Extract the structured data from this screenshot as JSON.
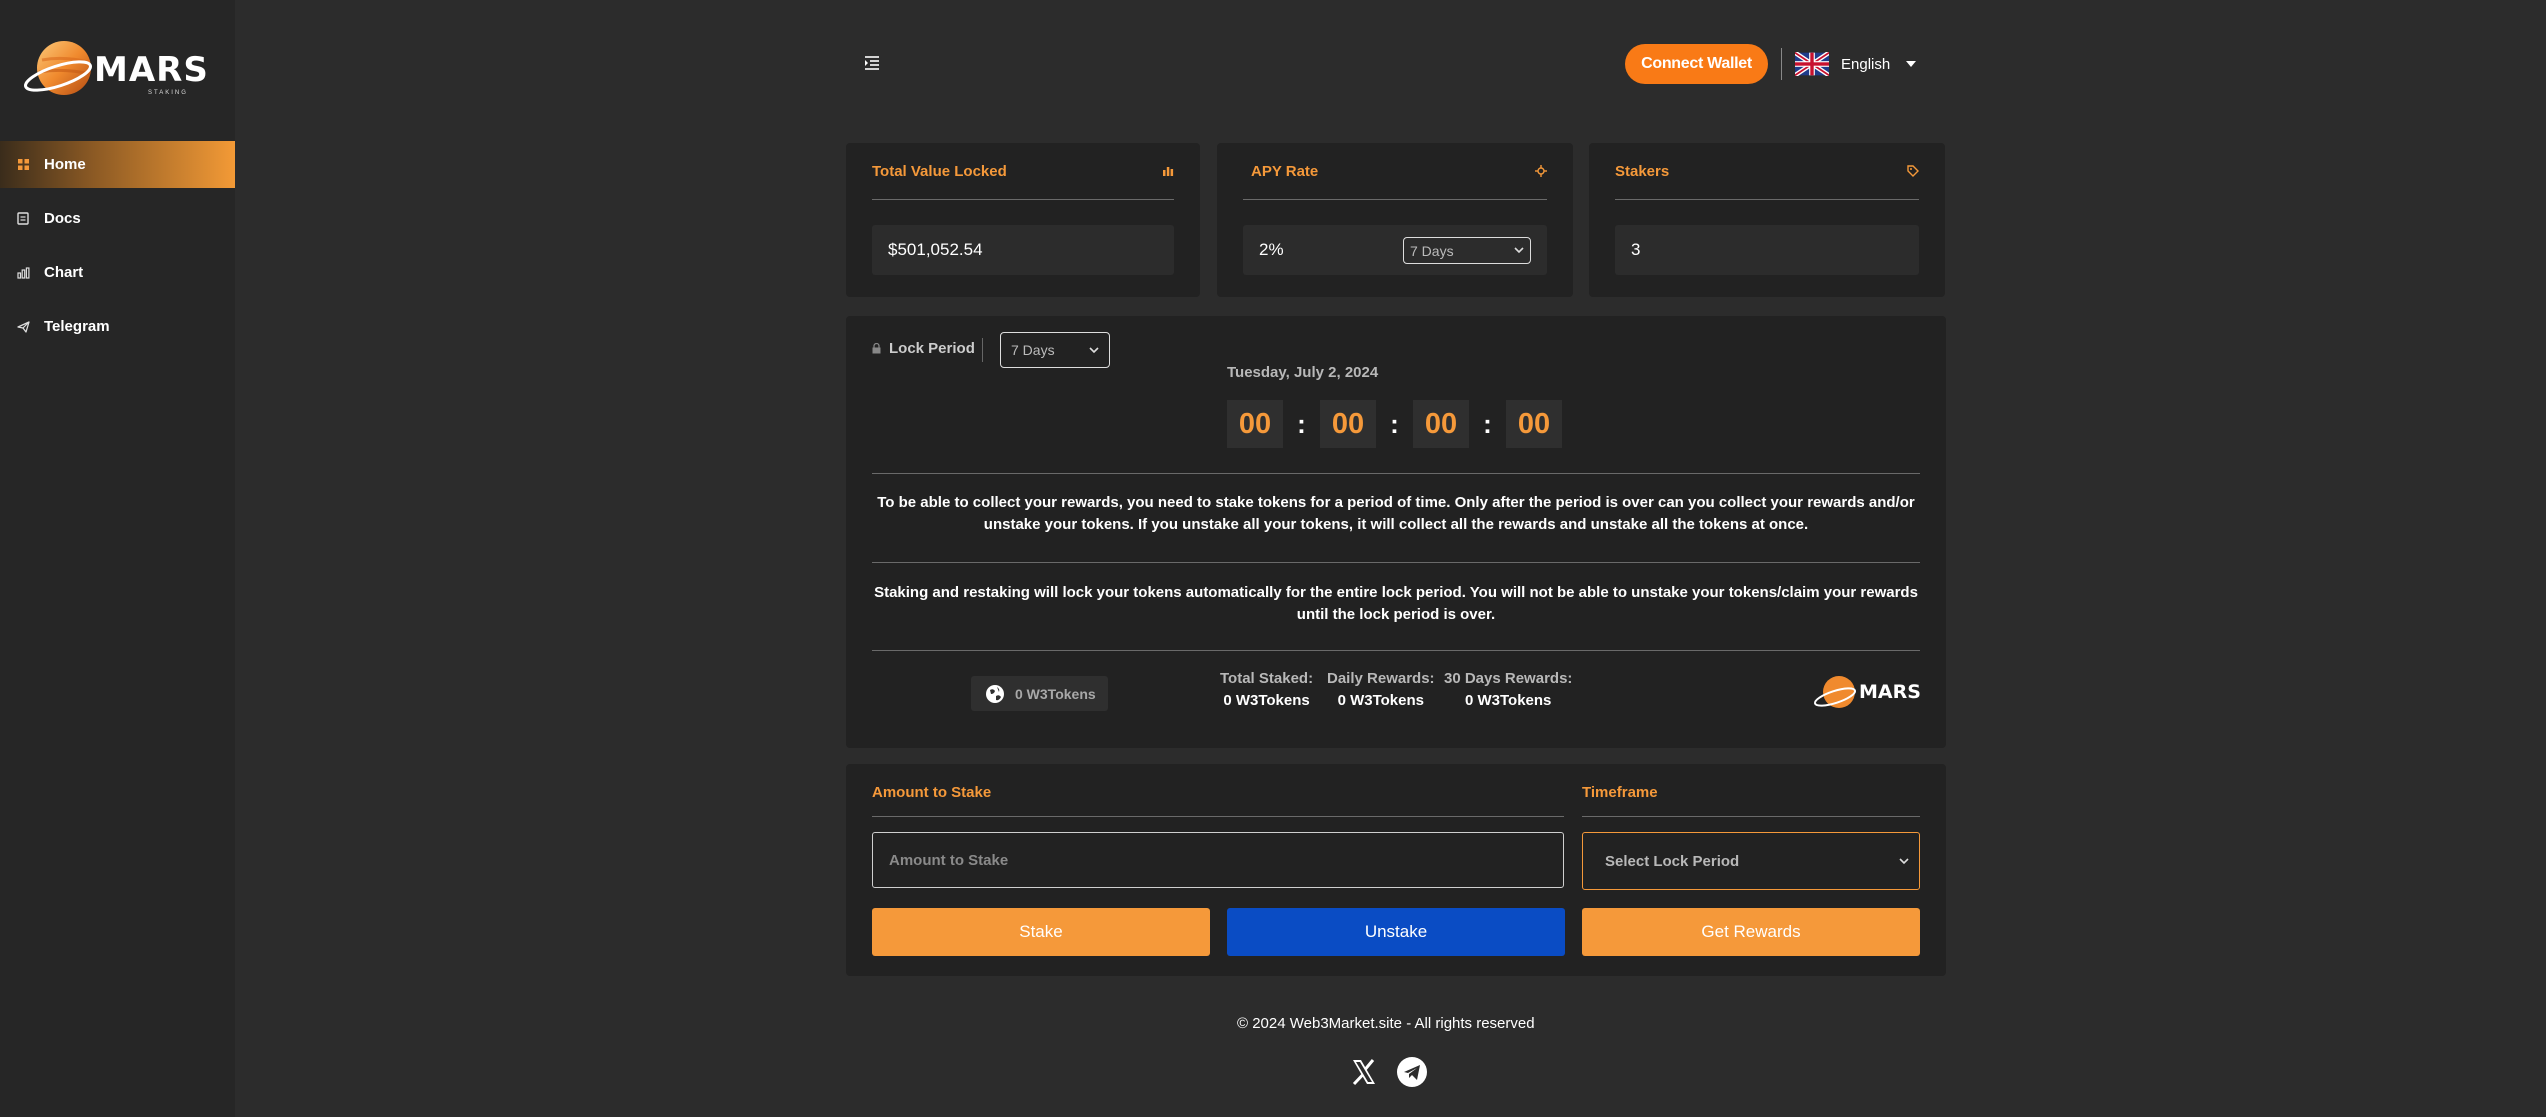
{
  "brand": {
    "name": "MARS",
    "subtitle": "STAKING"
  },
  "sidebar": {
    "items": [
      {
        "label": "Home",
        "icon": "grid-icon",
        "active": true
      },
      {
        "label": "Docs",
        "icon": "document-icon",
        "active": false
      },
      {
        "label": "Chart",
        "icon": "bar-chart-icon",
        "active": false
      },
      {
        "label": "Telegram",
        "icon": "send-icon",
        "active": false
      }
    ]
  },
  "header": {
    "connect_label": "Connect Wallet",
    "language": "English"
  },
  "cards": {
    "tvl": {
      "title": "Total Value Locked",
      "value": "$501,052.54"
    },
    "apy": {
      "title": "APY Rate",
      "value": "2%",
      "period": "7 Days"
    },
    "stakers": {
      "title": "Stakers",
      "value": "3"
    }
  },
  "lock": {
    "label": "Lock Period",
    "selected": "7 Days",
    "date": "Tuesday, July 2, 2024",
    "countdown": [
      "00",
      "00",
      "00",
      "00"
    ],
    "sep": ":",
    "info1": "To be able to collect your rewards, you need to stake tokens for a period of time. Only after the period is over can you collect your rewards and/or unstake your tokens. If you unstake all your tokens, it will collect all the rewards and unstake all the tokens at once.",
    "info2": "Staking and restaking will lock your tokens automatically for the entire lock period. You will not be able to unstake your tokens/claim your rewards until the lock period is over.",
    "balance": "0 W3Tokens",
    "stats": [
      {
        "label": "Total Staked:",
        "value": "0 W3Tokens"
      },
      {
        "label": "Daily Rewards:",
        "value": "0 W3Tokens"
      },
      {
        "label": "30 Days Rewards:",
        "value": "0 W3Tokens"
      }
    ],
    "logo_text": "MARS"
  },
  "stake": {
    "amount_label": "Amount to Stake",
    "amount_placeholder": "Amount to Stake",
    "timeframe_label": "Timeframe",
    "timeframe_placeholder": "Select Lock Period",
    "stake_label": "Stake",
    "unstake_label": "Unstake",
    "rewards_label": "Get Rewards"
  },
  "footer": {
    "copyright": "© 2024 Web3Market.site - All rights reserved"
  },
  "colors": {
    "accent": "#f5993a",
    "connect": "#f97a16",
    "unstake": "#0a4cc4",
    "bg": "#2c2c2c",
    "panel": "#222222"
  }
}
